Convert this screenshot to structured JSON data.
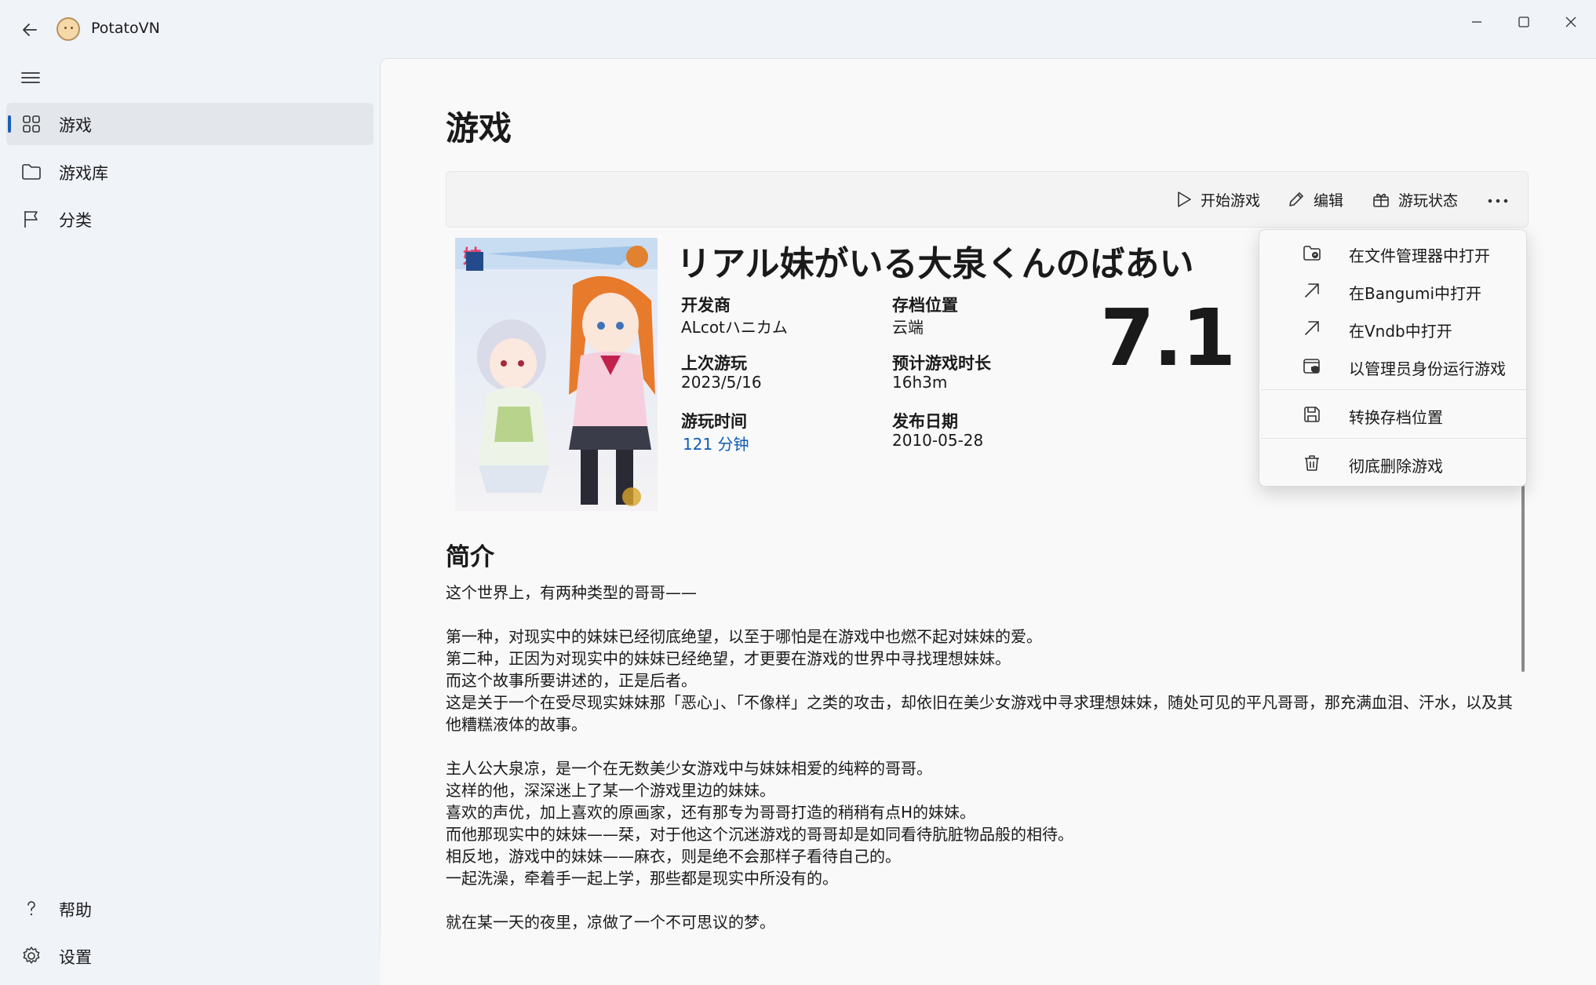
{
  "app": {
    "title": "PotatoVN"
  },
  "sidebar": {
    "items": [
      {
        "label": "游戏",
        "icon": "grid-icon",
        "active": true
      },
      {
        "label": "游戏库",
        "icon": "folder-icon",
        "active": false
      },
      {
        "label": "分类",
        "icon": "flag-icon",
        "active": false
      }
    ],
    "footer": [
      {
        "label": "帮助",
        "icon": "help-icon"
      },
      {
        "label": "设置",
        "icon": "settings-icon"
      }
    ]
  },
  "page": {
    "title": "游戏"
  },
  "toolbar": {
    "start_label": "开始游戏",
    "edit_label": "编辑",
    "status_label": "游玩状态"
  },
  "game": {
    "title": "リアル妹がいる大泉くんのばあい",
    "developer_label": "开发商",
    "developer": "ALcotハニカム",
    "save_location_label": "存档位置",
    "save_location": "云端",
    "last_played_label": "上次游玩",
    "last_played": "2023/5/16",
    "estimated_time_label": "预计游戏时长",
    "estimated_time": "16h3m",
    "playtime_label": "游玩时间",
    "playtime": "121 分钟",
    "release_date_label": "发布日期",
    "release_date": "2010-05-28",
    "rating": "7.1"
  },
  "description": {
    "title": "简介",
    "lines": [
      "这个世界上，有两种类型的哥哥——",
      "",
      "第一种，对现实中的妹妹已经彻底绝望，以至于哪怕是在游戏中也燃不起对妹妹的爱。",
      "第二种，正因为对现实中的妹妹已经绝望，才更要在游戏的世界中寻找理想妹妹。",
      "而这个故事所要讲述的，正是后者。",
      "这是关于一个在受尽现实妹妹那「恶心」、「不像样」之类的攻击，却依旧在美少女游戏中寻求理想妹妹，随处可见的平凡哥哥，那充满血泪、汗水，以及其他糟糕液体的故事。",
      "",
      "主人公大泉凉，是一个在无数美少女游戏中与妹妹相爱的纯粹的哥哥。",
      "这样的他，深深迷上了某一个游戏里边的妹妹。",
      "喜欢的声优，加上喜欢的原画家，还有那专为哥哥打造的稍稍有点H的妹妹。",
      "而他那现实中的妹妹——栞，对于他这个沉迷游戏的哥哥却是如同看待肮脏物品般的相待。",
      "相反地，游戏中的妹妹——麻衣，则是绝不会那样子看待自己的。",
      "一起洗澡，牵着手一起上学，那些都是现实中所没有的。",
      "",
      "就在某一天的夜里，凉做了一个不可思议的梦。"
    ]
  },
  "more_menu": {
    "items": [
      {
        "label": "在文件管理器中打开",
        "icon": "folder-open-icon"
      },
      {
        "label": "在Bangumi中打开",
        "icon": "external-link-icon"
      },
      {
        "label": "在Vndb中打开",
        "icon": "external-link-icon"
      },
      {
        "label": "以管理员身份运行游戏",
        "icon": "admin-shield-icon"
      },
      {
        "label": "转换存档位置",
        "icon": "save-icon"
      },
      {
        "label": "彻底删除游戏",
        "icon": "trash-icon"
      }
    ]
  }
}
